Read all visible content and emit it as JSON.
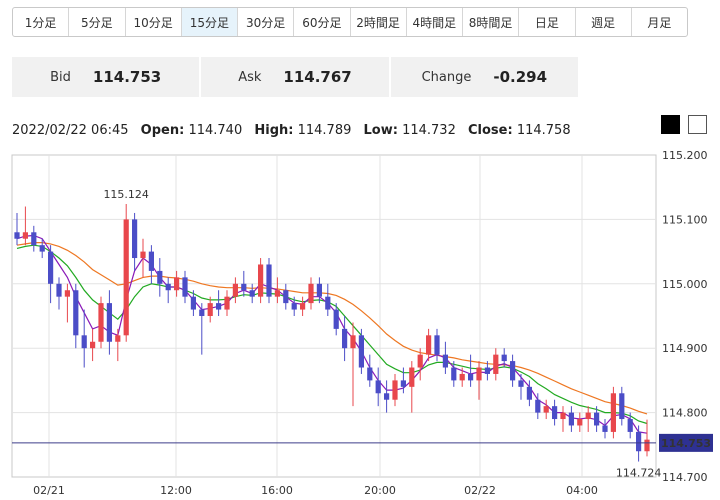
{
  "timeframes": [
    {
      "label": "1分足"
    },
    {
      "label": "5分足"
    },
    {
      "label": "10分足"
    },
    {
      "label": "15分足",
      "active": true
    },
    {
      "label": "30分足"
    },
    {
      "label": "60分足"
    },
    {
      "label": "2時間足"
    },
    {
      "label": "4時間足"
    },
    {
      "label": "8時間足"
    },
    {
      "label": "日足"
    },
    {
      "label": "週足"
    },
    {
      "label": "月足"
    }
  ],
  "quote": {
    "bid_label": "Bid",
    "bid_value": "114.753",
    "ask_label": "Ask",
    "ask_value": "114.767",
    "change_label": "Change",
    "change_value": "-0.294"
  },
  "ohlc": {
    "datetime": "2022/02/22 06:45",
    "open_label": "Open:",
    "open": "114.740",
    "high_label": "High:",
    "high": "114.789",
    "low_label": "Low:",
    "low": "114.732",
    "close_label": "Close:",
    "close": "114.758"
  },
  "chart_data": {
    "type": "candlestick",
    "ylim": [
      114.7,
      115.2
    ],
    "y_ticks": [
      "115.200",
      "115.100",
      "115.000",
      "114.900",
      "114.800",
      "114.700"
    ],
    "x_ticks": [
      "02/21",
      "12:00",
      "16:00",
      "20:00",
      "02/22",
      "04:00"
    ],
    "grid": true,
    "price_line": {
      "value": 114.753,
      "label": "114.753"
    },
    "annotations": [
      {
        "label": "115.124",
        "value": 115.124,
        "index": 13,
        "color": "#d9534f"
      },
      {
        "label": "114.724",
        "value": 114.724,
        "index": 74,
        "color": "#4a7fb5"
      }
    ],
    "colors": {
      "up": "#e8474c",
      "down": "#4b4dc7",
      "ma_fast": "#8a19b8",
      "ma_mid": "#22aa22",
      "ma_slow": "#ee7722"
    },
    "candles": [
      [
        115.08,
        115.11,
        115.06,
        115.07
      ],
      [
        115.07,
        115.12,
        115.06,
        115.08
      ],
      [
        115.08,
        115.09,
        115.05,
        115.06
      ],
      [
        115.06,
        115.07,
        115.04,
        115.05
      ],
      [
        115.05,
        115.06,
        114.97,
        115.0
      ],
      [
        115.0,
        115.01,
        114.96,
        114.98
      ],
      [
        114.98,
        115.0,
        114.94,
        114.99
      ],
      [
        114.99,
        115.0,
        114.9,
        114.92
      ],
      [
        114.92,
        114.96,
        114.87,
        114.9
      ],
      [
        114.9,
        114.93,
        114.88,
        114.91
      ],
      [
        114.91,
        114.98,
        114.9,
        114.97
      ],
      [
        114.97,
        114.99,
        114.89,
        114.91
      ],
      [
        114.91,
        114.93,
        114.88,
        114.92
      ],
      [
        114.92,
        115.124,
        114.91,
        115.1
      ],
      [
        115.1,
        115.11,
        115.02,
        115.04
      ],
      [
        115.04,
        115.07,
        115.01,
        115.05
      ],
      [
        115.05,
        115.06,
        115.0,
        115.02
      ],
      [
        115.02,
        115.04,
        114.98,
        115.0
      ],
      [
        115.0,
        115.01,
        114.97,
        114.99
      ],
      [
        114.99,
        115.02,
        114.98,
        115.01
      ],
      [
        115.01,
        115.02,
        114.97,
        114.98
      ],
      [
        114.98,
        114.99,
        114.95,
        114.96
      ],
      [
        114.96,
        114.97,
        114.89,
        114.95
      ],
      [
        114.95,
        114.98,
        114.94,
        114.97
      ],
      [
        114.97,
        114.99,
        114.95,
        114.96
      ],
      [
        114.96,
        114.99,
        114.95,
        114.98
      ],
      [
        114.98,
        115.01,
        114.97,
        115.0
      ],
      [
        115.0,
        115.02,
        114.98,
        114.99
      ],
      [
        114.99,
        115.0,
        114.97,
        114.98
      ],
      [
        114.98,
        115.04,
        114.97,
        115.03
      ],
      [
        115.03,
        115.04,
        114.97,
        114.98
      ],
      [
        114.98,
        115.01,
        114.97,
        114.99
      ],
      [
        114.99,
        115.0,
        114.96,
        114.97
      ],
      [
        114.97,
        114.98,
        114.95,
        114.96
      ],
      [
        114.96,
        114.98,
        114.95,
        114.97
      ],
      [
        114.97,
        115.01,
        114.96,
        115.0
      ],
      [
        115.0,
        115.01,
        114.97,
        114.98
      ],
      [
        114.98,
        115.0,
        114.95,
        114.96
      ],
      [
        114.96,
        114.97,
        114.92,
        114.93
      ],
      [
        114.93,
        114.95,
        114.88,
        114.9
      ],
      [
        114.9,
        114.94,
        114.81,
        114.92
      ],
      [
        114.92,
        114.93,
        114.86,
        114.87
      ],
      [
        114.87,
        114.89,
        114.84,
        114.85
      ],
      [
        114.85,
        114.87,
        114.81,
        114.83
      ],
      [
        114.83,
        114.85,
        114.8,
        114.82
      ],
      [
        114.82,
        114.86,
        114.81,
        114.85
      ],
      [
        114.85,
        114.87,
        114.83,
        114.84
      ],
      [
        114.84,
        114.88,
        114.8,
        114.87
      ],
      [
        114.87,
        114.9,
        114.85,
        114.89
      ],
      [
        114.89,
        114.93,
        114.88,
        114.92
      ],
      [
        114.92,
        114.93,
        114.88,
        114.89
      ],
      [
        114.89,
        114.91,
        114.86,
        114.87
      ],
      [
        114.87,
        114.88,
        114.84,
        114.85
      ],
      [
        114.85,
        114.87,
        114.84,
        114.86
      ],
      [
        114.86,
        114.89,
        114.84,
        114.85
      ],
      [
        114.85,
        114.88,
        114.82,
        114.87
      ],
      [
        114.87,
        114.88,
        114.85,
        114.86
      ],
      [
        114.86,
        114.9,
        114.85,
        114.89
      ],
      [
        114.89,
        114.9,
        114.87,
        114.88
      ],
      [
        114.88,
        114.89,
        114.84,
        114.85
      ],
      [
        114.85,
        114.86,
        114.82,
        114.84
      ],
      [
        114.84,
        114.85,
        114.81,
        114.82
      ],
      [
        114.82,
        114.83,
        114.79,
        114.8
      ],
      [
        114.8,
        114.82,
        114.79,
        114.81
      ],
      [
        114.81,
        114.82,
        114.78,
        114.79
      ],
      [
        114.79,
        114.81,
        114.77,
        114.8
      ],
      [
        114.8,
        114.81,
        114.77,
        114.78
      ],
      [
        114.78,
        114.8,
        114.77,
        114.79
      ],
      [
        114.79,
        114.81,
        114.77,
        114.8
      ],
      [
        114.8,
        114.81,
        114.77,
        114.78
      ],
      [
        114.78,
        114.79,
        114.76,
        114.77
      ],
      [
        114.77,
        114.84,
        114.76,
        114.83
      ],
      [
        114.83,
        114.84,
        114.78,
        114.79
      ],
      [
        114.79,
        114.8,
        114.76,
        114.77
      ],
      [
        114.77,
        114.78,
        114.724,
        114.74
      ],
      [
        114.74,
        114.789,
        114.732,
        114.758
      ]
    ],
    "series": [
      {
        "name": "",
        "values": [
          115.07,
          115.074,
          115.075,
          115.07,
          115.05,
          115.03,
          115.01,
          114.98,
          114.955,
          114.93,
          114.935,
          114.925,
          114.92,
          114.975,
          115.02,
          115.04,
          115.03,
          115.01,
          114.995,
          114.995,
          114.99,
          114.975,
          114.96,
          114.962,
          114.965,
          114.97,
          114.985,
          114.99,
          114.985,
          115.0,
          114.995,
          114.99,
          114.98,
          114.97,
          114.968,
          114.98,
          114.98,
          114.97,
          114.955,
          114.93,
          114.915,
          114.895,
          114.87,
          114.85,
          114.835,
          114.835,
          114.838,
          114.85,
          114.865,
          114.885,
          114.89,
          114.885,
          114.87,
          114.865,
          114.86,
          114.863,
          114.862,
          114.872,
          114.876,
          114.87,
          114.855,
          114.84,
          114.82,
          114.812,
          114.8,
          114.8,
          114.792,
          114.79,
          114.792,
          114.789,
          114.78,
          114.795,
          114.797,
          114.79,
          114.77,
          114.768
        ]
      },
      {
        "name": "",
        "values": [
          115.055,
          115.058,
          115.06,
          115.058,
          115.05,
          115.04,
          115.028,
          115.01,
          114.99,
          114.975,
          114.965,
          114.955,
          114.945,
          114.96,
          114.98,
          114.995,
          115.0,
          114.998,
          114.995,
          114.995,
          114.99,
          114.985,
          114.978,
          114.975,
          114.975,
          114.976,
          114.98,
          114.983,
          114.982,
          114.986,
          114.985,
          114.984,
          114.98,
          114.975,
          114.972,
          114.974,
          114.975,
          114.972,
          114.965,
          114.95,
          114.935,
          114.92,
          114.905,
          114.89,
          114.875,
          114.868,
          114.862,
          114.862,
          114.866,
          114.874,
          114.878,
          114.878,
          114.875,
          114.872,
          114.869,
          114.868,
          114.867,
          114.869,
          114.871,
          114.869,
          114.863,
          114.856,
          114.845,
          114.837,
          114.828,
          114.822,
          114.816,
          114.811,
          114.808,
          114.805,
          114.8,
          114.8,
          114.799,
          114.795,
          114.787,
          114.783
        ]
      },
      {
        "name": "",
        "values": [
          115.06,
          115.062,
          115.064,
          115.064,
          115.062,
          115.058,
          115.052,
          115.044,
          115.034,
          115.022,
          115.014,
          115.006,
          114.998,
          115.0,
          115.005,
          115.01,
          115.012,
          115.012,
          115.01,
          115.009,
          115.007,
          115.004,
          115.0,
          114.997,
          114.995,
          114.994,
          114.994,
          114.994,
          114.993,
          114.994,
          114.993,
          114.992,
          114.99,
          114.988,
          114.986,
          114.986,
          114.986,
          114.985,
          114.982,
          114.976,
          114.968,
          114.958,
          114.947,
          114.935,
          114.922,
          114.912,
          114.903,
          114.897,
          114.893,
          114.891,
          114.889,
          114.887,
          114.885,
          114.882,
          114.88,
          114.878,
          114.876,
          114.875,
          114.874,
          114.873,
          114.87,
          114.866,
          114.861,
          114.855,
          114.849,
          114.843,
          114.837,
          114.832,
          114.827,
          114.822,
          114.817,
          114.814,
          114.811,
          114.807,
          114.802,
          114.798
        ]
      }
    ]
  }
}
